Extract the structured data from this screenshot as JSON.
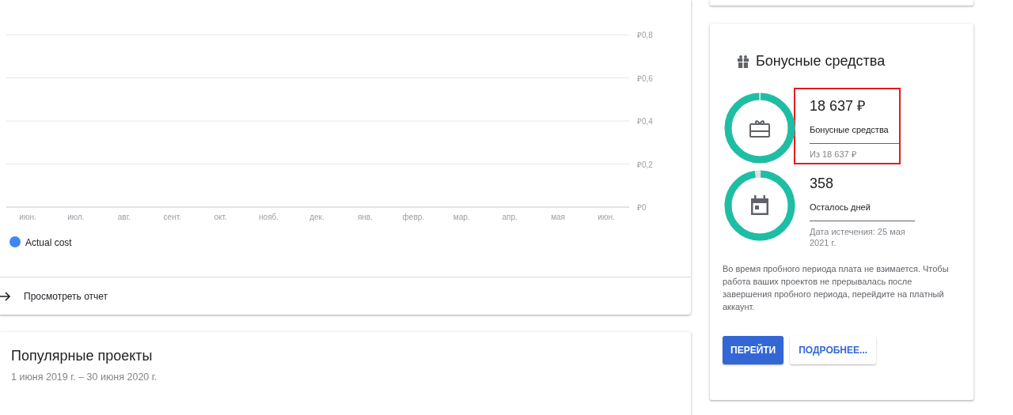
{
  "cost_card": {
    "chart_data": {
      "type": "line",
      "categories": [
        "июн.",
        "июл.",
        "авг.",
        "сент.",
        "окт.",
        "нояб.",
        "дек.",
        "янв.",
        "февр.",
        "мар.",
        "апр.",
        "мая",
        "июн."
      ],
      "series": [
        {
          "name": "Actual cost",
          "color": "#4285f4",
          "values": [
            null,
            null,
            null,
            null,
            null,
            null,
            null,
            null,
            null,
            null,
            null,
            null,
            null
          ]
        }
      ],
      "grid": true,
      "ylim": [
        0,
        0.8
      ],
      "yticks": [
        {
          "value": 0.8,
          "label": "₽0,8"
        },
        {
          "value": 0.6,
          "label": "₽0,6"
        },
        {
          "value": 0.4,
          "label": "₽0,4"
        },
        {
          "value": 0.2,
          "label": "₽0,2"
        },
        {
          "value": 0,
          "label": "₽0"
        }
      ]
    },
    "link": "Просмотреть отчет"
  },
  "projects_card": {
    "title": "Популярные проекты",
    "subtitle": "1 июня 2019 г. – 30 июня 2020 г."
  },
  "bonus_card": {
    "title": "Бонусные средства",
    "stats": [
      {
        "kind": "gift",
        "value": "18 637 ₽",
        "label": "Бонусные средства",
        "note": "Из 18 637 ₽",
        "level": 1,
        "highlighted": true
      },
      {
        "kind": "calendar",
        "value": "358",
        "label": "Осталось дней",
        "note": "Дата истечения: 25 мая 2021 г.",
        "level": 0.98,
        "highlighted": false
      }
    ],
    "text": "Во время пробного периода плата не взимается. Чтобы работа ваших проектов не прерывалась после завершения пробного периода, перейдите на платный аккаунт.",
    "buttons": [
      {
        "label": "ПЕРЕЙТИ",
        "kind": "primary"
      },
      {
        "label": "ПОДРОБНЕЕ...",
        "kind": "secondary"
      }
    ]
  }
}
